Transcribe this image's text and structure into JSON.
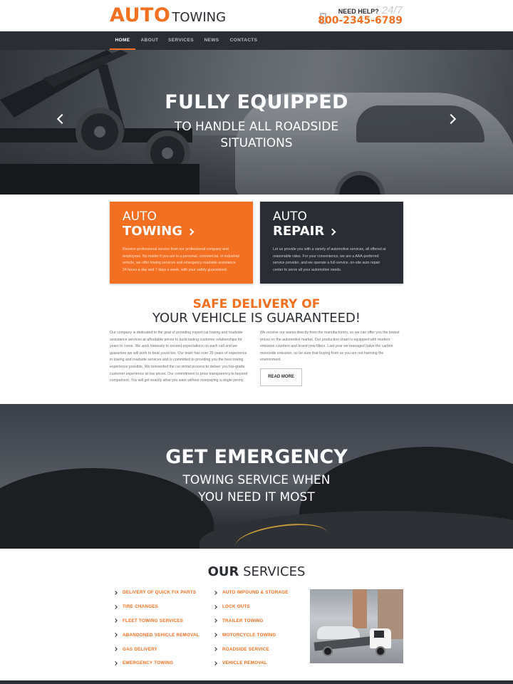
{
  "header": {
    "logo_auto": "AUTO",
    "logo_towing": "TOWING",
    "need_help": "NEED HELP?",
    "hours": "24/7",
    "phone": "800-2345-6789"
  },
  "nav": {
    "items": [
      {
        "label": "HOME",
        "active": true
      },
      {
        "label": "ABOUT",
        "active": false
      },
      {
        "label": "SERVICES",
        "active": false
      },
      {
        "label": "NEWS",
        "active": false
      },
      {
        "label": "CONTACTS",
        "active": false
      }
    ]
  },
  "hero": {
    "title": "FULLY EQUIPPED",
    "subtitle_line1": "TO HANDLE ALL  ROADSIDE",
    "subtitle_line2": "SITUATIONS"
  },
  "boxes": [
    {
      "small": "AUTO",
      "big": "TOWING",
      "text": "Receive professional service from our professional company and employees. No matter if you are in a personal, commercial, or industrial vehicle, we offer towing services and emergency roadside assistance 24 hours a day and 7 days a week, with your safety guaranteed."
    },
    {
      "small": "AUTO",
      "big": "REPAIR",
      "text": "Let us provide you with a variety of automotive services, all offered at reasonable rates. For your convenience, we are a AAA-preferred service provider, and we operate a full-service, on-site auto repair center to serve all your automotive needs."
    }
  ],
  "safe": {
    "title": "SAFE DELIVERY OF",
    "subtitle": "YOUR VEHICLE IS GUARANTEED!",
    "left_text": "Our company is dedicated to the goal of providing expert car towing and roadside assistance services at affordable prices to build lasting customer relationships for years to come. We work tirelessly to exceed expectations on each call and we guarantee we will work to beat yours too. Our team has over 25 years of experience in towing and roadside services and is committed to providing you the best towing experience possible. We reinvented the car rental process to deliver you top-grade customer experience at low prices. Our commitment to price transparency is beyond comparison. You will get exactly what you want without overpaying a single penny.",
    "right_text": "We receive our wares directly from the manufacturers, so we can offer you the lowest prices on the automotive market. Our production chain is equipped with modern emission counters and brand new filters. Last year we managed halve the carbon monoxide emission, so be sure that buying from us you are not harming the environment.",
    "button": "READ MORE"
  },
  "emergency": {
    "title": "GET EMERGENCY",
    "subtitle_line1": "TOWING SERVICE WHEN",
    "subtitle_line2": "YOU NEED IT MOST"
  },
  "services": {
    "title_bold": "OUR",
    "title_rest": "SERVICES",
    "col1": [
      "DELIVERY OF QUICK FIX PARTS",
      "TIRE CHANGES",
      "FLEET TOWING SERVICES",
      "ABANDONED VEHICLE REMOVAL",
      "GAS DELIVERY",
      "EMERGENCY TOWING"
    ],
    "col2": [
      "AUTO IMPOUND & STORAGE",
      "LOCK OUTS",
      "TRAILER TOWING",
      "MOTORCYCLE TOWING",
      "ROADSIDE SERVICE",
      "VEHICLE REMOVAL"
    ]
  },
  "colors": {
    "accent": "#f36f21",
    "dark": "#2a2d33"
  }
}
